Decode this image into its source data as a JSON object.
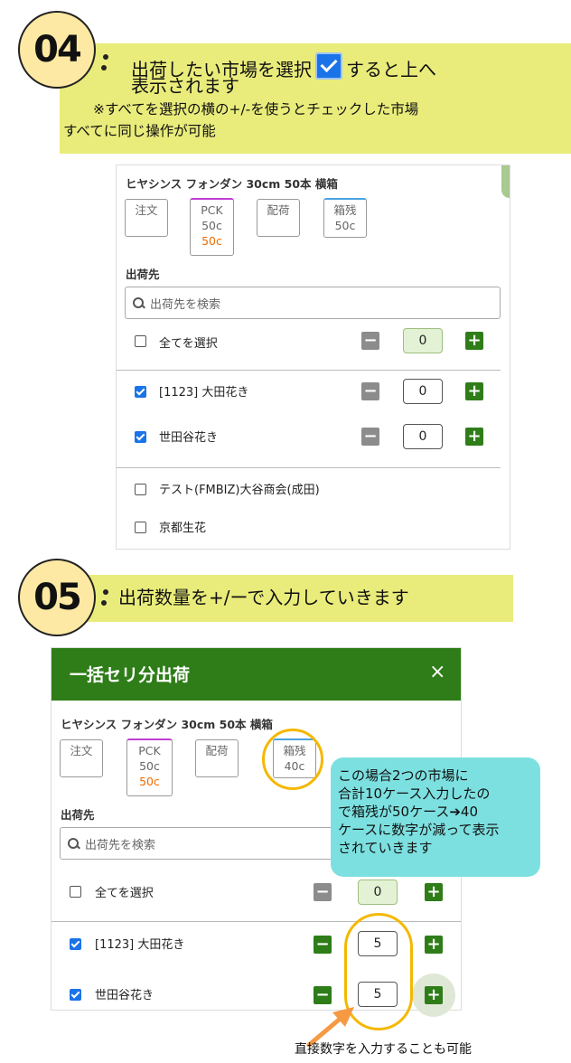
{
  "step4": {
    "number": "04",
    "line1_a": "出荷したい市場を選択",
    "line1_b": "すると上へ",
    "line2": "表示されます",
    "note1": "※すべてを選択の横の+/-を使うとチェックした市場",
    "note2": "すべてに同じ操作が可能"
  },
  "step5": {
    "number": "05",
    "text": "出荷数量を+/ーで入力していきます"
  },
  "panel1": {
    "product": "ヒヤシンス フォンダン 30cm 50本 横箱",
    "tags": {
      "order": "注文",
      "pck": "PCK",
      "pck_val": "50c",
      "pck_val2": "50c",
      "haika": "配荷",
      "box": "箱残",
      "box_val": "50c"
    },
    "dest_label": "出荷先",
    "search_placeholder": "出荷先を検索",
    "select_all": "全てを選択",
    "select_all_qty": "0",
    "rows": [
      {
        "label": "[1123] 大田花き",
        "qty": "0"
      },
      {
        "label": "世田谷花き",
        "qty": "0"
      }
    ],
    "unchecked": [
      "テスト(FMBIZ)大谷商会(成田)",
      "京都生花"
    ]
  },
  "panel2": {
    "header": "一括セリ分出荷",
    "close": "×",
    "product": "ヒヤシンス フォンダン 30cm 50本 横箱",
    "tags": {
      "order": "注文",
      "pck": "PCK",
      "pck_val": "50c",
      "pck_val2": "50c",
      "haika": "配荷",
      "box": "箱残",
      "box_val": "40c"
    },
    "dest_label": "出荷先",
    "search_placeholder": "出荷先を検索",
    "select_all": "全てを選択",
    "select_all_qty": "0",
    "rows": [
      {
        "label": "[1123] 大田花き",
        "qty": "5"
      },
      {
        "label": "世田谷花き",
        "qty": "5"
      }
    ]
  },
  "bubble_lines": [
    "この場合2つの市場に",
    "合計10ケース入力したの",
    "で箱残が50ケース➔40",
    "ケースに数字が減って表示",
    "されていきます"
  ],
  "footnote": "直接数字を入力することも可能",
  "colors": {
    "banner": "#e9ec7a",
    "green": "#2e7d18",
    "ring": "#f5b800",
    "bubble": "#7de0e0",
    "arrow": "#f59a42"
  }
}
